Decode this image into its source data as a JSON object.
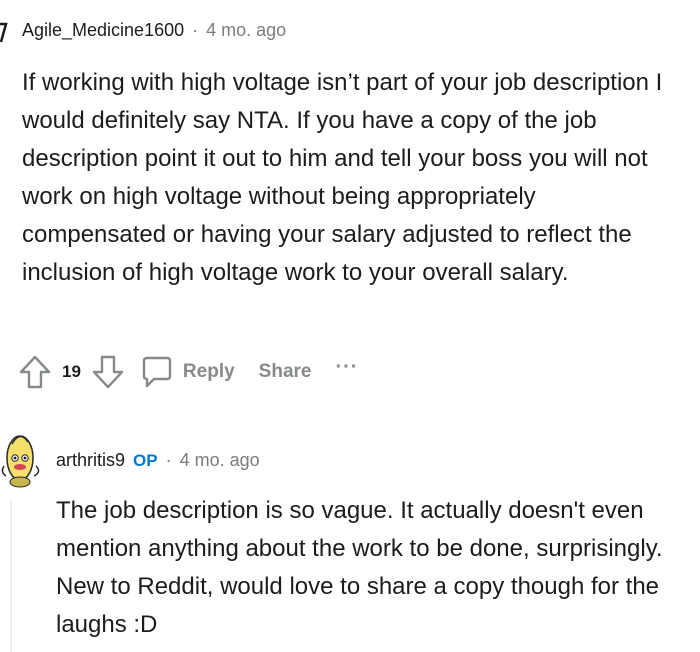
{
  "comment1": {
    "username": "Agile_Medicine1600",
    "separator": "·",
    "timestamp": "4 mo. ago",
    "body": "If working with high voltage isn’t part of your job description I would definitely say NTA. If you have a copy of the job description point it out to him and tell your boss you will not work on high voltage without being appropriately compensated or having your salary adjusted to reflect the inclusion of high voltage work to your overall salary.",
    "votes": "19",
    "reply_label": "Reply",
    "share_label": "Share",
    "more_label": "···"
  },
  "comment2": {
    "username": "arthritis9",
    "op_badge": "OP",
    "separator": "·",
    "timestamp": "4 mo. ago",
    "body": "The job description is so vague. It actually doesn't even mention anything about the work to be done, surprisingly. New to Reddit, would love to share a copy though for the laughs :D"
  },
  "colors": {
    "accent": "#0079d3",
    "meta": "#7c7c7c",
    "action": "#878a8c"
  }
}
